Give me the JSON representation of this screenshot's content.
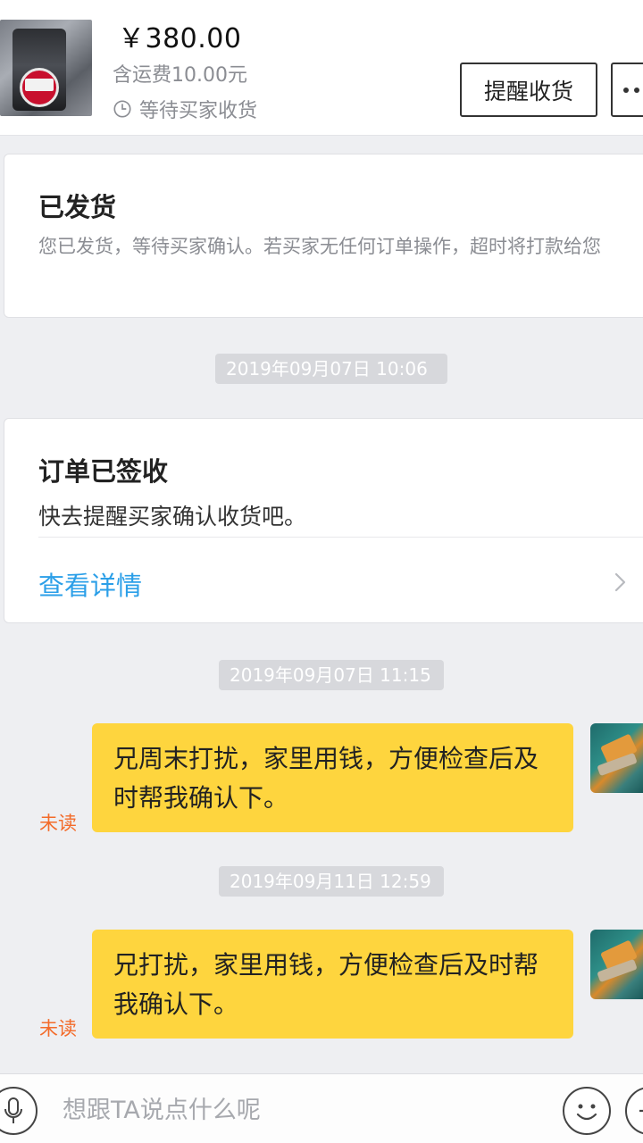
{
  "product": {
    "price": "￥380.00",
    "shipping": "含运费10.00元",
    "status": "等待买家收货",
    "remind_button": "提醒收货",
    "more_button": "··"
  },
  "shipped_card": {
    "title": "已发货",
    "description": "您已发货，等待买家确认。若买家无任何订单操作，超时将打款给您"
  },
  "timestamps": [
    "2019年09月07日 10:06",
    "2019年09月07日 11:15",
    "2019年09月11日 12:59"
  ],
  "signed_card": {
    "title": "订单已签收",
    "description": "快去提醒买家确认收货吧。",
    "link": "查看详情"
  },
  "messages": [
    {
      "text": "兄周末打扰，家里用钱，方便检查后及时帮我确认下。",
      "status": "未读"
    },
    {
      "text": "兄打扰，家里用钱，方便检查后及时帮我确认下。",
      "status": "未读"
    }
  ],
  "input": {
    "placeholder": "想跟TA说点什么呢"
  },
  "icons": {
    "clock": "clock-icon",
    "chevron": "chevron-right-icon",
    "mic": "microphone-icon",
    "emoji": "emoji-icon",
    "plus": "plus-icon"
  },
  "colors": {
    "accent_link": "#2b9fe8",
    "bubble": "#fed53e",
    "unread": "#f36b2a"
  }
}
